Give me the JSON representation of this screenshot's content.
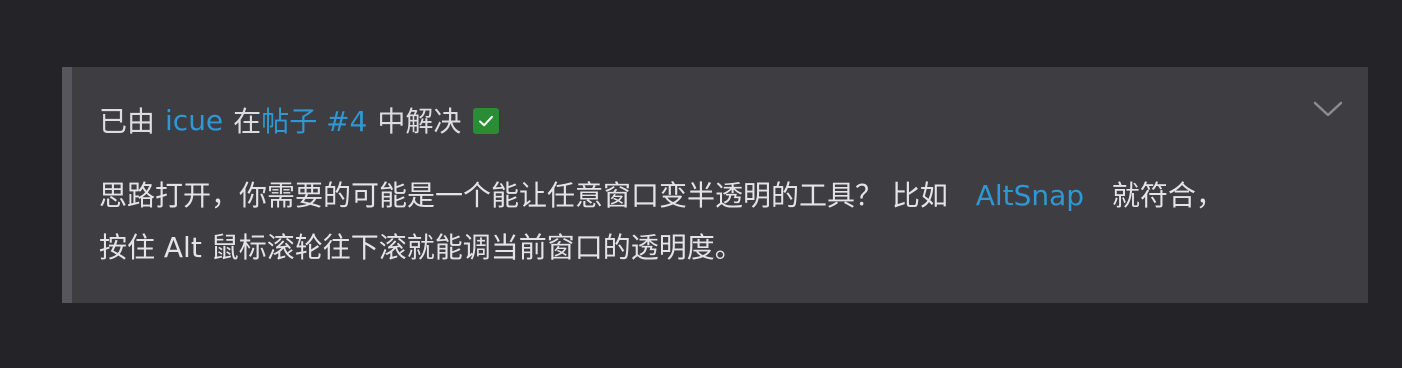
{
  "solution": {
    "prefix": "已由",
    "user": "icue",
    "in_text": "在",
    "post_link": "帖子 #4",
    "suffix": "中解决",
    "badge_icon": "checkbox-checked-icon",
    "badge_color": "#2a8d36",
    "toggle_icon": "chevron-down-icon",
    "line1_before": "思路打开，你需要的可能是一个能让任意窗口变半透明的工具？ 比如",
    "link_text": "AltSnap",
    "line1_after": "就符合，",
    "line2": "按住 Alt 鼠标滚轮往下滚就能调当前窗口的透明度。"
  },
  "colors": {
    "background": "#242327",
    "box": "#3e3d42",
    "border": "#57565c",
    "link": "#2e97d4",
    "text": "#e4e4e6"
  }
}
